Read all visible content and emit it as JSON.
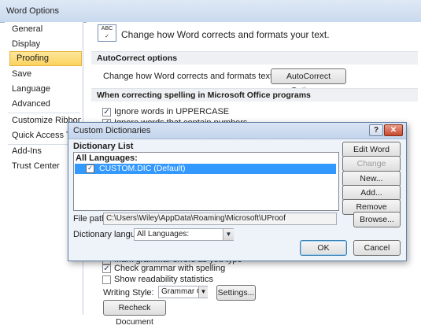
{
  "window": {
    "title": "Word Options"
  },
  "sidebar": {
    "items": [
      {
        "label": "General"
      },
      {
        "label": "Display"
      },
      {
        "label": "Proofing"
      },
      {
        "label": "Save"
      },
      {
        "label": "Language"
      },
      {
        "label": "Advanced"
      },
      {
        "label": "Customize Ribbon"
      },
      {
        "label": "Quick Access Toolbar"
      },
      {
        "label": "Add-Ins"
      },
      {
        "label": "Trust Center"
      }
    ],
    "active": "Proofing"
  },
  "main": {
    "header_text": "Change how Word corrects and formats your text.",
    "header_icon": "abc-check-icon",
    "autocorrect_section": "AutoCorrect options",
    "autocorrect_text": "Change how Word corrects and formats text as you type:",
    "autocorrect_button": "AutoCorrect Options...",
    "spelling_section": "When correcting spelling in Microsoft Office programs",
    "check_uppercase": "Ignore words in UPPERCASE",
    "check_numbers": "Ignore words that contain numbers",
    "check_grammar_partial": "Mark grammar errors as you type",
    "check_grammar": "Check grammar with spelling",
    "check_readability": "Show readability statistics",
    "writing_style_label": "Writing Style:",
    "writing_style_value": "Grammar Only",
    "settings_button": "Settings...",
    "recheck_button": "Recheck Document"
  },
  "dialog": {
    "title": "Custom Dictionaries",
    "help_glyph": "?",
    "close_glyph": "✕",
    "list_label": "Dictionary List",
    "group_label": "All Languages:",
    "dictionary_item": "CUSTOM.DIC (Default)",
    "buttons": {
      "edit": "Edit Word List...",
      "change_default": "Change Default",
      "new": "New...",
      "add": "Add...",
      "remove": "Remove",
      "browse": "Browse...",
      "ok": "OK",
      "cancel": "Cancel"
    },
    "file_path_label": "File path:",
    "file_path_value": "C:\\Users\\Wiley\\AppData\\Roaming\\Microsoft\\UProof",
    "language_label": "Dictionary language:",
    "language_value": "All Languages:"
  }
}
